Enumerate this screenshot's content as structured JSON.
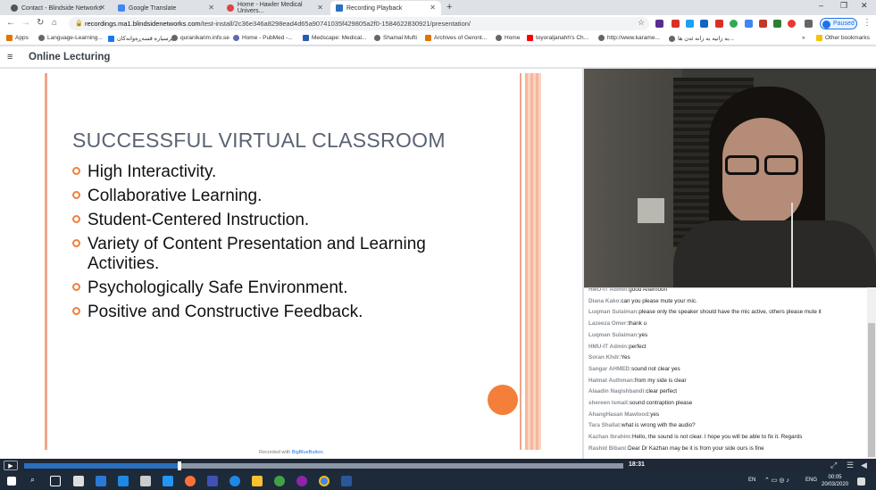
{
  "browser": {
    "tabs": [
      {
        "label": "Contact - Blindside Networks",
        "active": false
      },
      {
        "label": "Google Translate",
        "active": false
      },
      {
        "label": "Home - Hawler Medical Univers...",
        "active": false
      },
      {
        "label": "Recording Playback",
        "active": true
      }
    ],
    "new_tab_glyph": "+",
    "url_domain": "recordings.ma1.blindsidenetworks.com",
    "url_path": "/test-install/2c36e346a8298ead4d65a90741035f429805a2f0-1584622830921/presentation/",
    "profile_label": "Paused",
    "bookmarks": [
      "Apps",
      "Language-Learning...",
      "پرسیارە قسەڕەوانەکان",
      "quranikarim.info.se",
      "Home - PubMed -...",
      "Medscape: Medical...",
      "Shamal Mufti",
      "Archives of Geront...",
      "Home",
      "toyoraljanahh's Ch...",
      "http://www.karame...",
      "بە زانیە بە زانە ئەن ها...",
      "Other bookmarks"
    ]
  },
  "app": {
    "title": "Online Lecturing",
    "menu_glyph": "≡"
  },
  "slide": {
    "title": "SUCCESSFUL VIRTUAL CLASSROOM",
    "bullets": [
      "High Interactivity.",
      "Collaborative Learning.",
      "Student-Centered Instruction.",
      "Variety of Content Presentation and Learning Activities.",
      "Psychologically Safe Environment.",
      "Positive and Constructive Feedback."
    ],
    "footer_prefix": "Recorded with ",
    "footer_link": "BigBlueButton."
  },
  "chat": {
    "messages": [
      {
        "who": "HMU-IT Admin:",
        "text": "good Afternoon"
      },
      {
        "who": "Diana Kako:",
        "text": "can you please mute your mic."
      },
      {
        "who": "Luqman Sulaiman:",
        "text": "please only the speaker should have the mic active, others please mute it"
      },
      {
        "who": "Lazeeza Omer:",
        "text": "thank u"
      },
      {
        "who": "Luqman Sulaiman:",
        "text": "yes"
      },
      {
        "who": "HMU-IT Admin:",
        "text": "perfect"
      },
      {
        "who": "Soran Khdr:",
        "text": "Yes"
      },
      {
        "who": "Sangar AHMED:",
        "text": "sound not clear yes"
      },
      {
        "who": "Halmat Authman:",
        "text": "from my side is clear"
      },
      {
        "who": "Alaadin Naqishbandi:",
        "text": "clear perfect"
      },
      {
        "who": "shereen Ismail:",
        "text": "sound contraption please"
      },
      {
        "who": "AhangHasan Mawlood:",
        "text": "yes"
      },
      {
        "who": "Tara Shallal:",
        "text": "what is wrong with the audio?"
      },
      {
        "who": "Kazhan Ibrahim:",
        "text": "Hello, the sound is not clear. I hope you will be able to fix it. Regards"
      },
      {
        "who": "Rashid Bibani:",
        "text": "Dear Dr Kazhan may be it is from your side ours is fine"
      }
    ]
  },
  "player": {
    "time": "18:31",
    "progress_fraction": 0.26,
    "play_glyph": "▶"
  },
  "taskbar": {
    "lang1": "EN",
    "lang2": "ENG",
    "time": "00:05",
    "date": "20/03/2020"
  },
  "colors": {
    "accent_orange": "#f47f3b",
    "slide_title": "#5a6373",
    "player_bg": "#1e2836"
  }
}
